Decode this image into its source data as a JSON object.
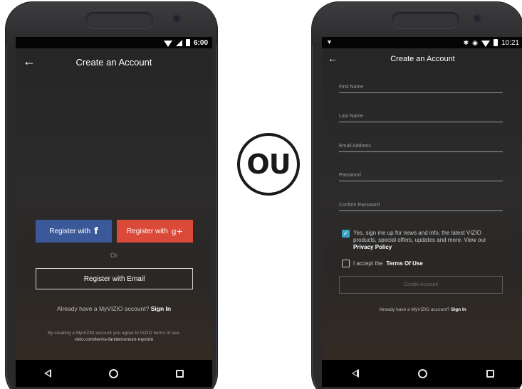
{
  "left_phone": {
    "status_time": "6:00",
    "title": "Create an Account",
    "register_facebook_label": "Register with",
    "facebook_glyph": "f",
    "register_google_label": "Register with",
    "google_glyph": "g+",
    "or_text": "Or",
    "register_email_label": "Register with Email",
    "already_text": "Already have a MyVIZIO account?",
    "sign_in_label": "Sign In",
    "terms_line1": "By creating a MyVIZIO account you agree to VIZIO terms of use.",
    "terms_url": "vizio.com/terms-fandemonium-myvizio"
  },
  "badge": {
    "text": "OU"
  },
  "right_phone": {
    "status_time": "10:21",
    "title": "Create an Account",
    "fields": {
      "first_name": "First Name",
      "last_name": "Last Name",
      "email": "Email Address",
      "password": "Password",
      "confirm_password": "Confirm Password"
    },
    "newsletter_text": "Yes, sign me up for news and info, the latest VIZIO products, special offers, updates and more. View our",
    "privacy_policy_label": "Privacy Policy",
    "newsletter_checked": true,
    "accept_text": "I accept the",
    "terms_of_use_label": "Terms Of Use",
    "terms_checked": false,
    "create_account_label": "Create Account",
    "already_text": "Already have a MyVIZIO account?",
    "sign_in_label": "Sign In"
  },
  "colors": {
    "facebook": "#3b5898",
    "google": "#db4a39",
    "checkbox_accent": "#39a1c7",
    "app_background": "#2a2a2a"
  },
  "icons": {
    "back": "arrow-left-icon",
    "nav_back": "triangle-back-icon",
    "nav_home": "circle-home-icon",
    "nav_recent": "square-recents-icon",
    "facebook": "facebook-icon",
    "google_plus": "google-plus-icon",
    "checkbox_checked": "checkmark-icon"
  }
}
